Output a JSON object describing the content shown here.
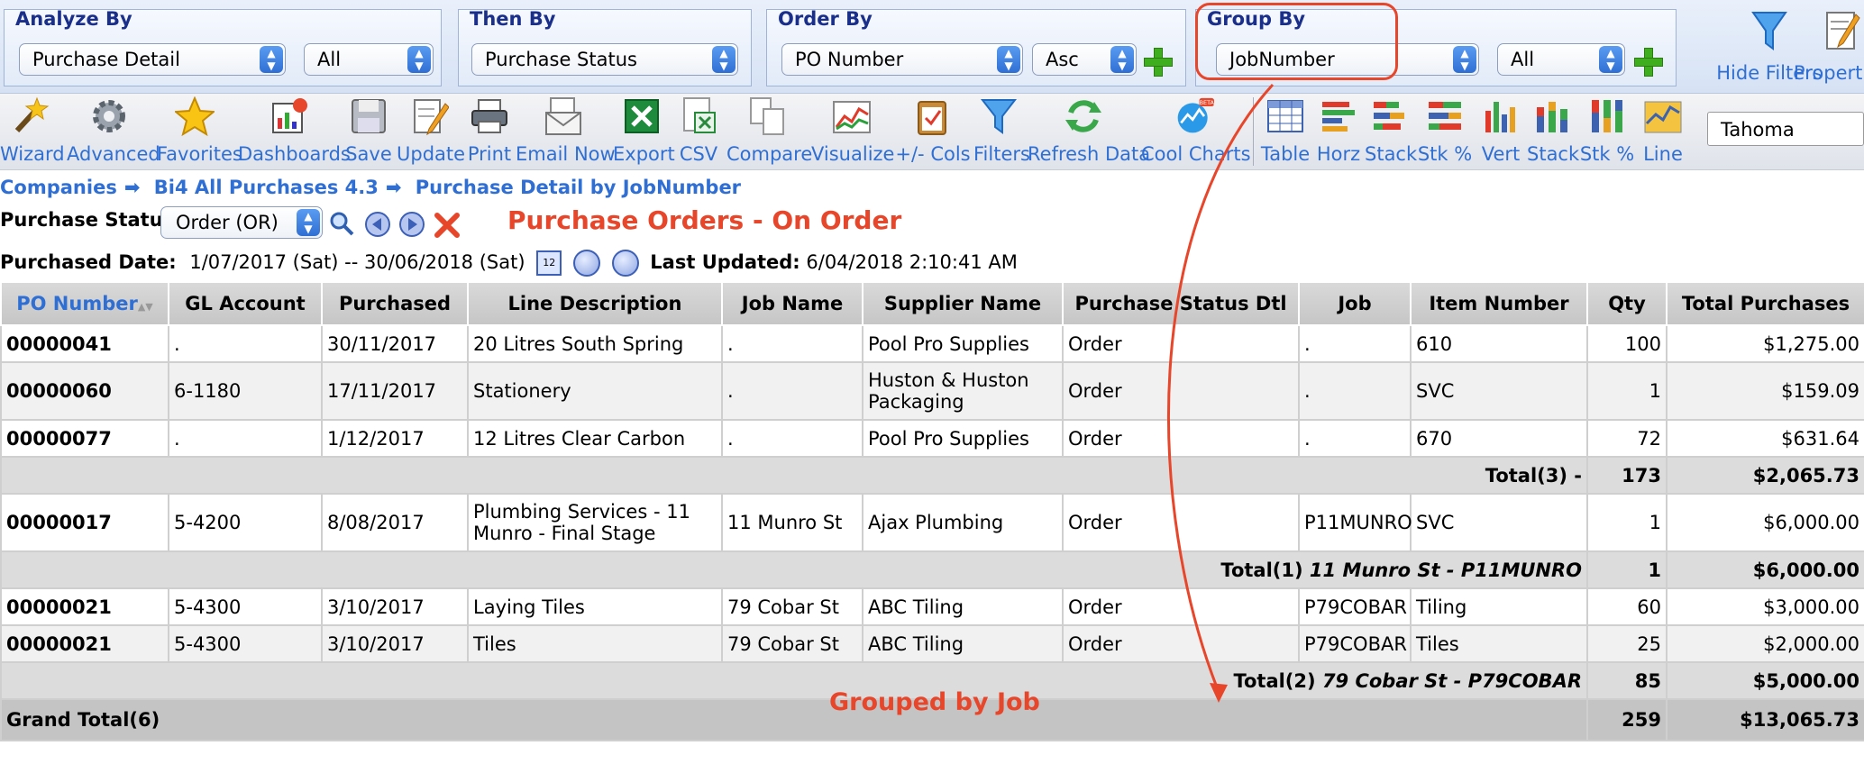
{
  "filters": {
    "analyze_by": {
      "title": "Analyze By",
      "value": "Purchase Detail",
      "value2": "All"
    },
    "then_by": {
      "title": "Then By",
      "value": "Purchase Status"
    },
    "order_by": {
      "title": "Order By",
      "value": "PO Number",
      "value2": "Asc"
    },
    "group_by": {
      "title": "Group By",
      "value": "JobNumber",
      "value2": "All"
    },
    "hide_filters_label": "Hide Filters",
    "properties_label": "Properties"
  },
  "toolbar": {
    "items": [
      "Wizard",
      "Advanced",
      "Favorites",
      "Dashboards",
      "Save",
      "Update",
      "Print",
      "Email Now",
      "Export",
      "CSV",
      "Compare",
      "Visualize",
      "+/- Cols",
      "Filters",
      "Refresh Data",
      "Cool Charts"
    ],
    "chart_items": [
      "Table",
      "Horz",
      "Stack",
      "Stk %",
      "Vert",
      "Stack",
      "Stk %",
      "Line"
    ],
    "font": "Tahoma",
    "beta_badge": "BETA"
  },
  "breadcrumb": [
    "Companies",
    "Bi4 All Purchases 4.3",
    "Purchase Detail by JobNumber"
  ],
  "breadcrumb_sep": "➡",
  "purchase_status": {
    "label": "Purchase Status",
    "value": "Order (OR)"
  },
  "report_title": "Purchase Orders - On Order",
  "dates": {
    "label": "Purchased Date:",
    "range": "1/07/2017 (Sat) -- 30/06/2018 (Sat)",
    "calendar_badge": "12",
    "updated_label": "Last Updated:",
    "updated_value": "6/04/2018 2:10:41 AM"
  },
  "table": {
    "headers": [
      "PO Number",
      "GL Account",
      "Purchased",
      "Line Description",
      "Job Name",
      "Supplier Name",
      "Purchase Status Dtl",
      "Job",
      "Item Number",
      "Qty",
      "Total Purchases"
    ],
    "rows": [
      [
        "00000041",
        ".",
        "30/11/2017",
        "20 Litres South Spring",
        ".",
        "Pool Pro Supplies",
        "Order",
        ".",
        "610",
        "100",
        "$1,275.00"
      ],
      [
        "00000060",
        "6-1180",
        "17/11/2017",
        "Stationery",
        ".",
        "Huston & Huston Packaging",
        "Order",
        ".",
        "SVC",
        "1",
        "$159.09"
      ],
      [
        "00000077",
        ".",
        "1/12/2017",
        "12 Litres Clear Carbon",
        ".",
        "Pool Pro Supplies",
        "Order",
        ".",
        "670",
        "72",
        "$631.64"
      ],
      [
        "00000017",
        "5-4200",
        "8/08/2017",
        "Plumbing Services - 11 Munro - Final Stage",
        "11 Munro St",
        "Ajax Plumbing",
        "Order",
        "P11MUNRO",
        "SVC",
        "1",
        "$6,000.00"
      ],
      [
        "00000021",
        "5-4300",
        "3/10/2017",
        "Laying Tiles",
        "79 Cobar St",
        "ABC Tiling",
        "Order",
        "P79COBAR",
        "Tiling",
        "60",
        "$3,000.00"
      ],
      [
        "00000021",
        "5-4300",
        "3/10/2017",
        "Tiles",
        "79 Cobar St",
        "ABC Tiling",
        "Order",
        "P79COBAR",
        "Tiles",
        "25",
        "$2,000.00"
      ]
    ],
    "totals": [
      {
        "label": "Total(3) -",
        "group": "",
        "qty": "173",
        "amount": "$2,065.73"
      },
      {
        "label": "Total(1)",
        "group": "11 Munro St - P11MUNRO",
        "qty": "1",
        "amount": "$6,000.00"
      },
      {
        "label": "Total(2)",
        "group": "79 Cobar St - P79COBAR",
        "qty": "85",
        "amount": "$5,000.00"
      }
    ],
    "grand": {
      "label": "Grand Total(6)",
      "qty": "259",
      "amount": "$13,065.73"
    }
  },
  "annotation": "Grouped by Job",
  "colors": {
    "accent": "#2f6fd4",
    "annotation_red": "#e8462a",
    "title_navy": "#1a2f8a"
  }
}
